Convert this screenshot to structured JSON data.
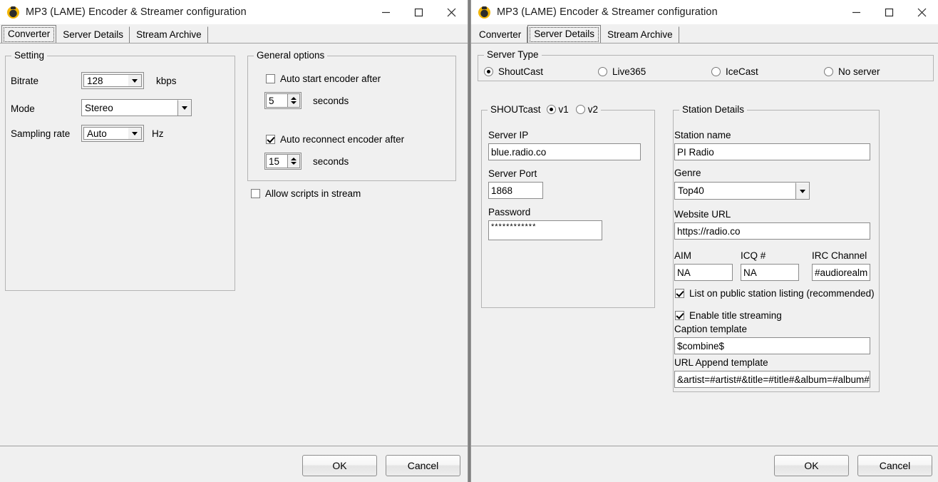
{
  "window_title": "MP3 (LAME) Encoder & Streamer configuration",
  "window_controls": {
    "minimize": "minimize-icon",
    "maximize": "maximize-icon",
    "close": "close-icon"
  },
  "tabs": [
    {
      "label": "Converter"
    },
    {
      "label": "Server Details"
    },
    {
      "label": "Stream Archive"
    }
  ],
  "left_window": {
    "active_tab": "Converter",
    "setting_group": {
      "legend": "Setting",
      "bitrate_label": "Bitrate",
      "bitrate_value": "128",
      "bitrate_unit": "kbps",
      "mode_label": "Mode",
      "mode_value": "Stereo",
      "sampling_label": "Sampling rate",
      "sampling_value": "Auto",
      "sampling_unit": "Hz"
    },
    "general_group": {
      "legend": "General options",
      "auto_start_label": "Auto start encoder after",
      "auto_start_checked": false,
      "auto_start_value": "5",
      "auto_start_unit": "seconds",
      "auto_reconnect_label": "Auto reconnect encoder after",
      "auto_reconnect_checked": true,
      "auto_reconnect_value": "15",
      "auto_reconnect_unit": "seconds"
    },
    "allow_scripts_label": "Allow scripts in stream",
    "allow_scripts_checked": false,
    "ok_label": "OK",
    "cancel_label": "Cancel"
  },
  "right_window": {
    "active_tab": "Server Details",
    "server_type_group": {
      "legend": "Server Type",
      "options": [
        {
          "label": "ShoutCast",
          "selected": true
        },
        {
          "label": "Live365",
          "selected": false
        },
        {
          "label": "IceCast",
          "selected": false
        },
        {
          "label": "No server",
          "selected": false
        }
      ]
    },
    "shoutcast_group": {
      "legend": "SHOUTcast",
      "version_v1": "v1",
      "version_v2": "v2",
      "version_selected": "v1",
      "server_ip_label": "Server IP",
      "server_ip_value": "blue.radio.co",
      "server_port_label": "Server Port",
      "server_port_value": "1868",
      "password_label": "Password",
      "password_value": "************"
    },
    "station_group": {
      "legend": "Station Details",
      "station_name_label": "Station name",
      "station_name_value": "PI Radio",
      "genre_label": "Genre",
      "genre_value": "Top40",
      "website_label": "Website URL",
      "website_value": "https://radio.co",
      "aim_label": "AIM",
      "aim_value": "NA",
      "icq_label": "ICQ #",
      "icq_value": "NA",
      "irc_label": "IRC Channel",
      "irc_value": "#audiorealm",
      "list_public_label": "List on public station listing (recommended)",
      "list_public_checked": true,
      "enable_title_label": "Enable title streaming",
      "enable_title_checked": true,
      "caption_label": "Caption template",
      "caption_value": "$combine$",
      "url_append_label": "URL Append template",
      "url_append_value": "&artist=#artist#&title=#title#&album=#album#"
    },
    "ok_label": "OK",
    "cancel_label": "Cancel"
  }
}
